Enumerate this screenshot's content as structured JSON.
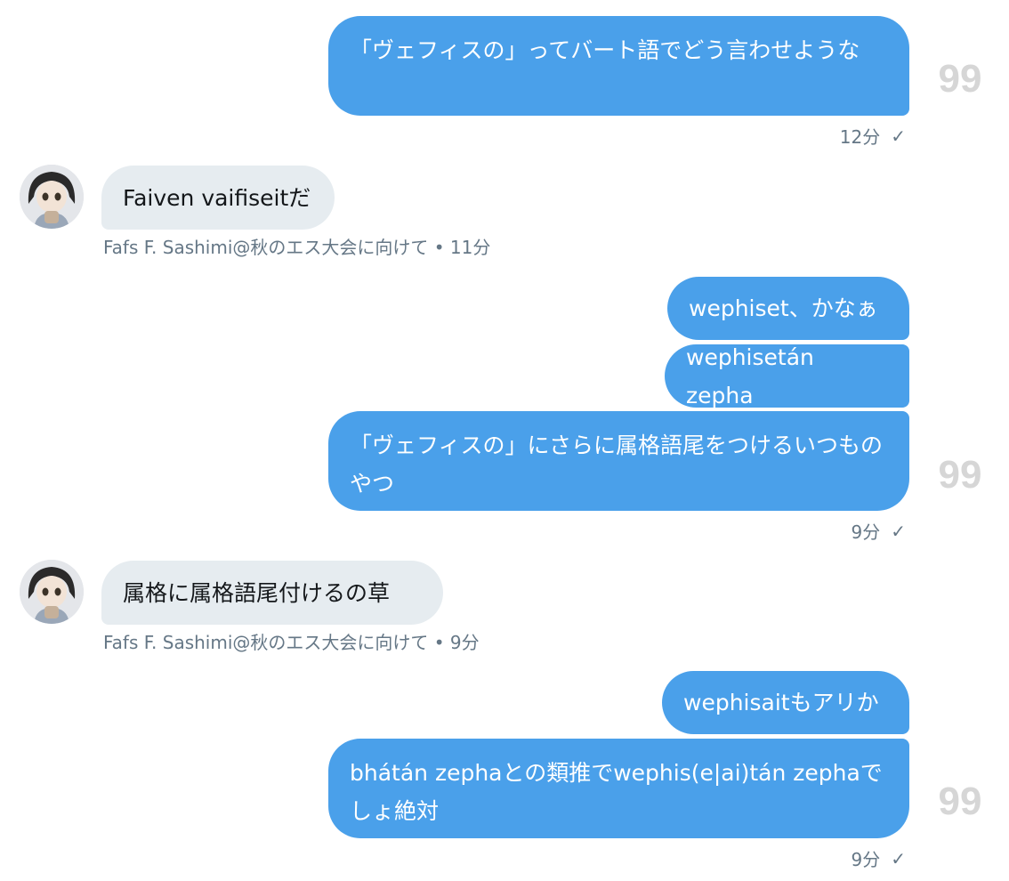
{
  "messages": [
    {
      "text": "「ヴェフィスの」ってバート語でどう言わせような",
      "time": "12分"
    },
    {
      "text": "Faiven vaifiseitだ"
    },
    {
      "text": "wephiset、かなぁ"
    },
    {
      "text": "wephisetán zepha"
    },
    {
      "text": "「ヴェフィスの」にさらに属格語尾をつけるいつものやつ",
      "time": "9分"
    },
    {
      "text": "属格に属格語尾付けるの草"
    },
    {
      "text": "wephisaitもアリか"
    },
    {
      "text": "bhátán zephaとの類推でwephis(e|ai)tán zephaでしょ絶対",
      "time": "9分"
    }
  ],
  "incoming_meta": [
    {
      "author": "Fafs F. Sashimi@秋のエス大会に向けて",
      "separator": "•",
      "time": "11分"
    },
    {
      "author": "Fafs F. Sashimi@秋のエス大会に向けて",
      "separator": "•",
      "time": "9分"
    }
  ],
  "status": {
    "sent_icon": "check-icon",
    "check_glyph": "✓"
  },
  "read_receipt": {
    "label": "99"
  },
  "colors": {
    "outgoing": "#4aa0ea",
    "incoming": "#e6ecf0",
    "meta": "#657786"
  }
}
